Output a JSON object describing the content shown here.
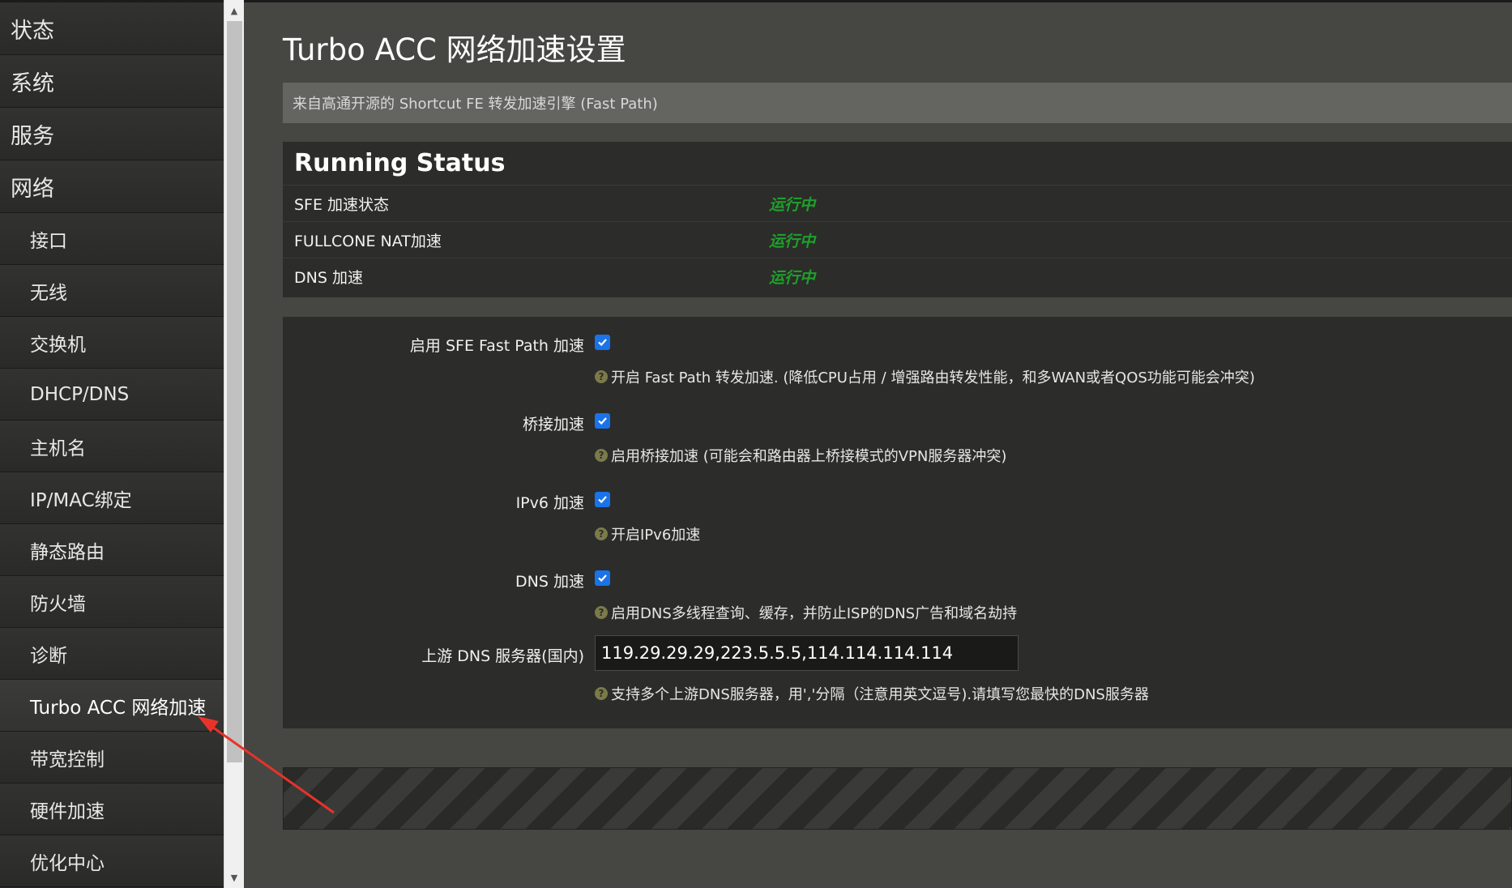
{
  "sidebar": {
    "items": [
      {
        "label": "状态",
        "level": "top",
        "active": false
      },
      {
        "label": "系统",
        "level": "top",
        "active": false
      },
      {
        "label": "服务",
        "level": "top",
        "active": false
      },
      {
        "label": "网络",
        "level": "top",
        "active": false
      },
      {
        "label": "接口",
        "level": "sub",
        "active": false
      },
      {
        "label": "无线",
        "level": "sub",
        "active": false
      },
      {
        "label": "交换机",
        "level": "sub",
        "active": false
      },
      {
        "label": "DHCP/DNS",
        "level": "sub",
        "active": false
      },
      {
        "label": "主机名",
        "level": "sub",
        "active": false
      },
      {
        "label": "IP/MAC绑定",
        "level": "sub",
        "active": false
      },
      {
        "label": "静态路由",
        "level": "sub",
        "active": false
      },
      {
        "label": "防火墙",
        "level": "sub",
        "active": false
      },
      {
        "label": "诊断",
        "level": "sub",
        "active": false
      },
      {
        "label": "Turbo ACC 网络加速",
        "level": "sub",
        "active": true
      },
      {
        "label": "带宽控制",
        "level": "sub",
        "active": false
      },
      {
        "label": "硬件加速",
        "level": "sub",
        "active": false
      },
      {
        "label": "优化中心",
        "level": "sub",
        "active": false
      }
    ]
  },
  "main": {
    "title": "Turbo ACC 网络加速设置",
    "description": "来自高通开源的 Shortcut FE 转发加速引擎 (Fast Path)",
    "status": {
      "title": "Running Status",
      "rows": [
        {
          "label": "SFE 加速状态",
          "value": "运行中"
        },
        {
          "label": "FULLCONE NAT加速",
          "value": "运行中"
        },
        {
          "label": "DNS 加速",
          "value": "运行中"
        }
      ]
    },
    "settings": {
      "sfe": {
        "label": "启用 SFE Fast Path 加速",
        "checked": true,
        "help": "开启 Fast Path 转发加速. (降低CPU占用 / 增强路由转发性能，和多WAN或者QOS功能可能会冲突)"
      },
      "bridge": {
        "label": "桥接加速",
        "checked": true,
        "help": "启用桥接加速 (可能会和路由器上桥接模式的VPN服务器冲突)"
      },
      "ipv6": {
        "label": "IPv6 加速",
        "checked": true,
        "help": "开启IPv6加速"
      },
      "dns": {
        "label": "DNS 加速",
        "checked": true,
        "help": "启用DNS多线程查询、缓存，并防止ISP的DNS广告和域名劫持"
      },
      "upstream": {
        "label": "上游 DNS 服务器(国内)",
        "value": "119.29.29.29,223.5.5.5,114.114.114.114",
        "help": "支持多个上游DNS服务器，用','分隔（注意用英文逗号).请填写您最快的DNS服务器"
      }
    },
    "icons": {
      "help": "help-icon",
      "checkbox": "checkmark-icon"
    }
  },
  "colors": {
    "status_running": "#1ea12a",
    "checkbox": "#1a73e8",
    "annotation_arrow": "#e8322a"
  }
}
